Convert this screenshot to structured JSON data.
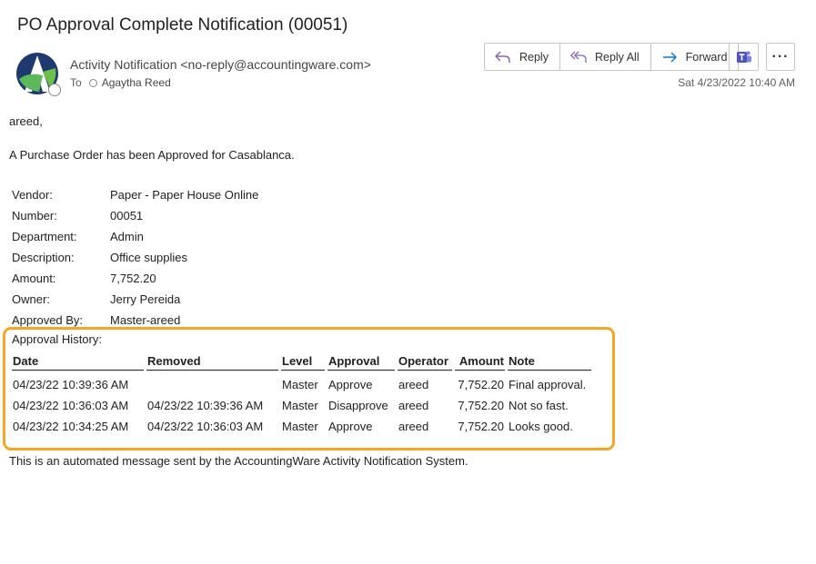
{
  "email": {
    "subject": "PO Approval Complete Notification (00051)",
    "from": "Activity Notification <no-reply@accountingware.com>",
    "to_label": "To",
    "to_recipient": "Agaytha Reed",
    "date": "Sat 4/23/2022 10:40 AM"
  },
  "actions": {
    "reply": "Reply",
    "reply_all": "Reply All",
    "forward": "Forward"
  },
  "icons": {
    "avatar": "accountingware-logo-icon",
    "reply": "reply-arrow-icon",
    "reply_all": "reply-all-arrow-icon",
    "forward": "forward-arrow-icon",
    "teams": "microsoft-teams-icon",
    "more": "more-dots-icon"
  },
  "colors": {
    "highlight": "#f5a623",
    "reply_icon": "#8764b8",
    "forward_icon": "#0078d4",
    "teams": "#4b53bc"
  },
  "body": {
    "greeting": "areed,",
    "intro": "A Purchase Order has been Approved for Casablanca.",
    "details": [
      {
        "key": "Vendor:",
        "value": "Paper - Paper House Online"
      },
      {
        "key": "Number:",
        "value": "00051"
      },
      {
        "key": "Department:",
        "value": "Admin"
      },
      {
        "key": "Description:",
        "value": "Office supplies"
      },
      {
        "key": "Amount:",
        "value": "7,752.20"
      },
      {
        "key": "Owner:",
        "value": "Jerry Pereida"
      },
      {
        "key": "Approved By:",
        "value": "Master-areed"
      }
    ],
    "history_title": "Approval History:",
    "history_columns": [
      "Date",
      "Removed",
      "Level",
      "Approval",
      "Operator",
      "Amount",
      "Note"
    ],
    "history_rows": [
      [
        "04/23/22 10:39:36 AM",
        "",
        "Master",
        "Approve",
        "areed",
        "7,752.20",
        "Final approval."
      ],
      [
        "04/23/22 10:36:03 AM",
        "04/23/22 10:39:36 AM",
        "Master",
        "Disapprove",
        "areed",
        "7,752.20",
        "Not so fast."
      ],
      [
        "04/23/22 10:34:25 AM",
        "04/23/22 10:36:03 AM",
        "Master",
        "Approve",
        "areed",
        "7,752.20",
        "Looks good."
      ]
    ],
    "footer": "This is an automated message sent by the AccountingWare Activity Notification System."
  }
}
